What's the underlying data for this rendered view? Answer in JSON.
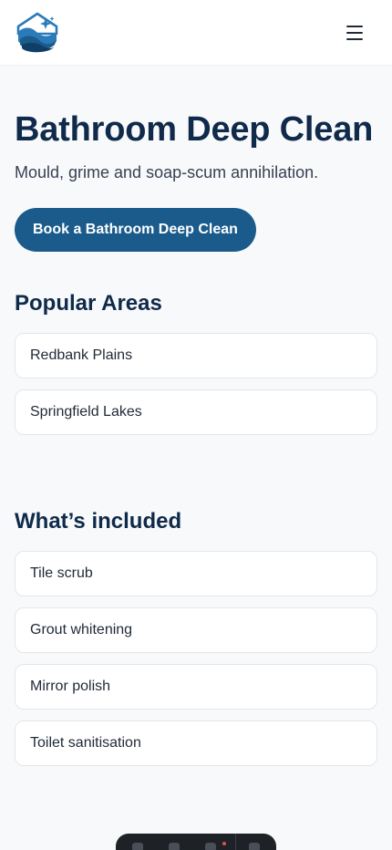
{
  "header": {
    "logo_icon": "wave-sparkle-logo-icon",
    "menu_icon": "hamburger-menu-icon"
  },
  "hero": {
    "title": "Bathroom Deep Clean",
    "subtitle": "Mould, grime and soap-scum annihilation.",
    "cta_label": "Book a Bathroom Deep Clean"
  },
  "popular_areas": {
    "title": "Popular Areas",
    "items": [
      "Redbank Plains",
      "Springfield Lakes"
    ]
  },
  "included": {
    "title": "What’s included",
    "items": [
      "Tile scrub",
      "Grout whitening",
      "Mirror polish",
      "Toilet sanitisation"
    ]
  },
  "colors": {
    "brand_primary": "#1a5b8c",
    "heading": "#0f2a4a",
    "background": "#f8f9fb"
  }
}
